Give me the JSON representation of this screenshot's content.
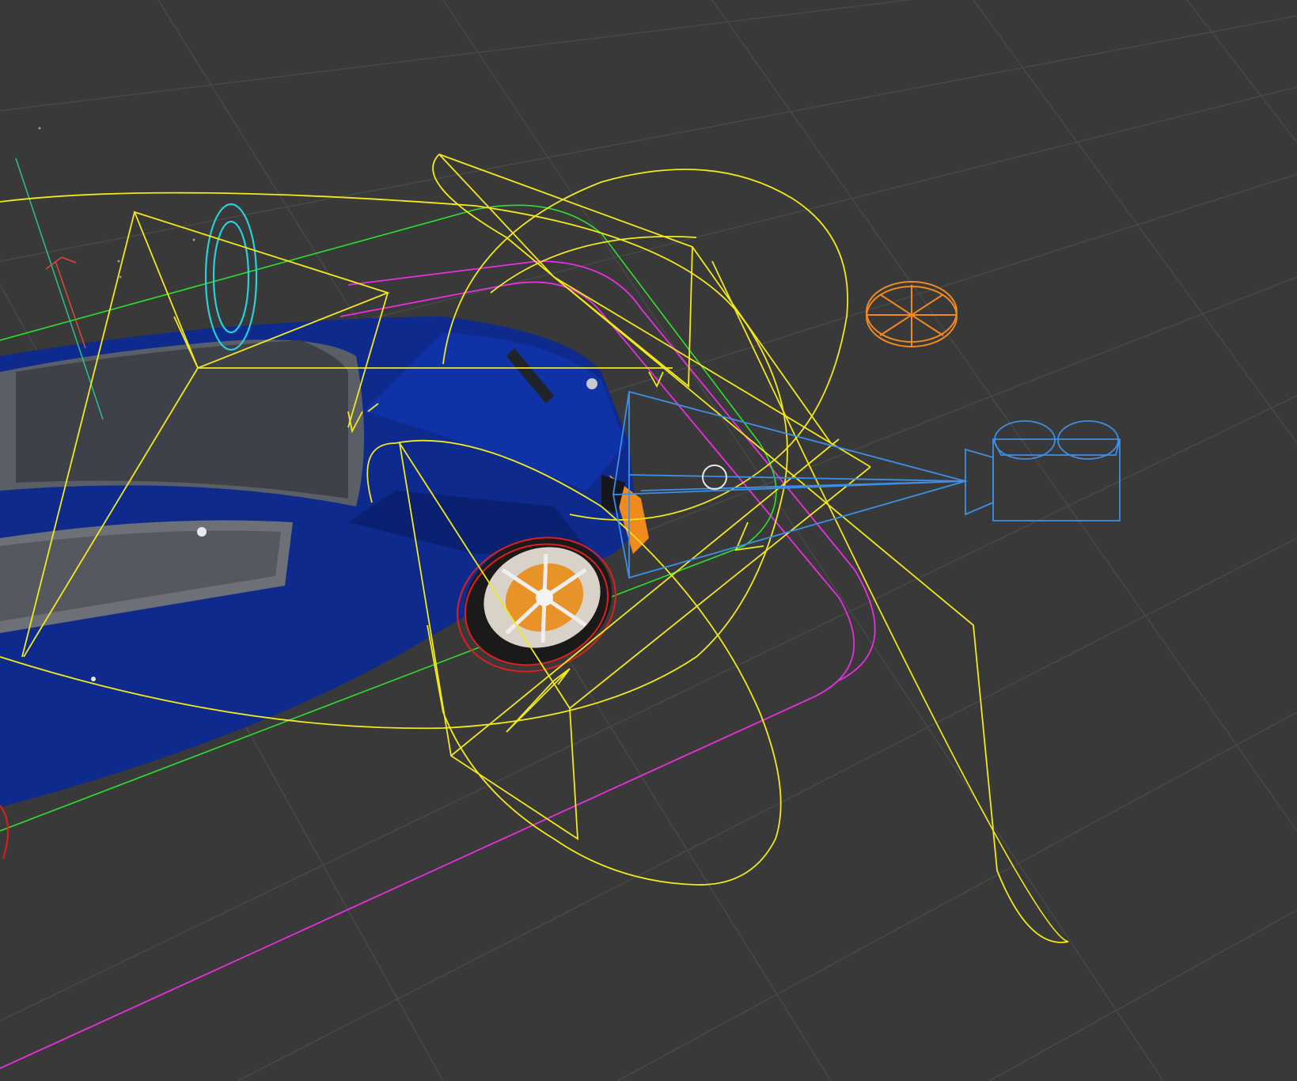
{
  "viewport": {
    "label": "",
    "background": "#393939",
    "grid_color": "#4a4a4a"
  },
  "scene_objects": [
    {
      "name": "car-body",
      "color": "#0d2a8c"
    },
    {
      "name": "spot-light-gizmos",
      "color": "#f2e81c"
    },
    {
      "name": "camera-gizmo",
      "color": "#3d8fe6"
    },
    {
      "name": "point-light-gizmo",
      "color": "#f08a1e"
    },
    {
      "name": "audio-source-ring",
      "color": "#28d0dc"
    },
    {
      "name": "bounds-green",
      "color": "#2ee02e"
    },
    {
      "name": "bounds-magenta",
      "color": "#e82fe0"
    },
    {
      "name": "wheel-collider",
      "color": "#e01e1e"
    }
  ]
}
